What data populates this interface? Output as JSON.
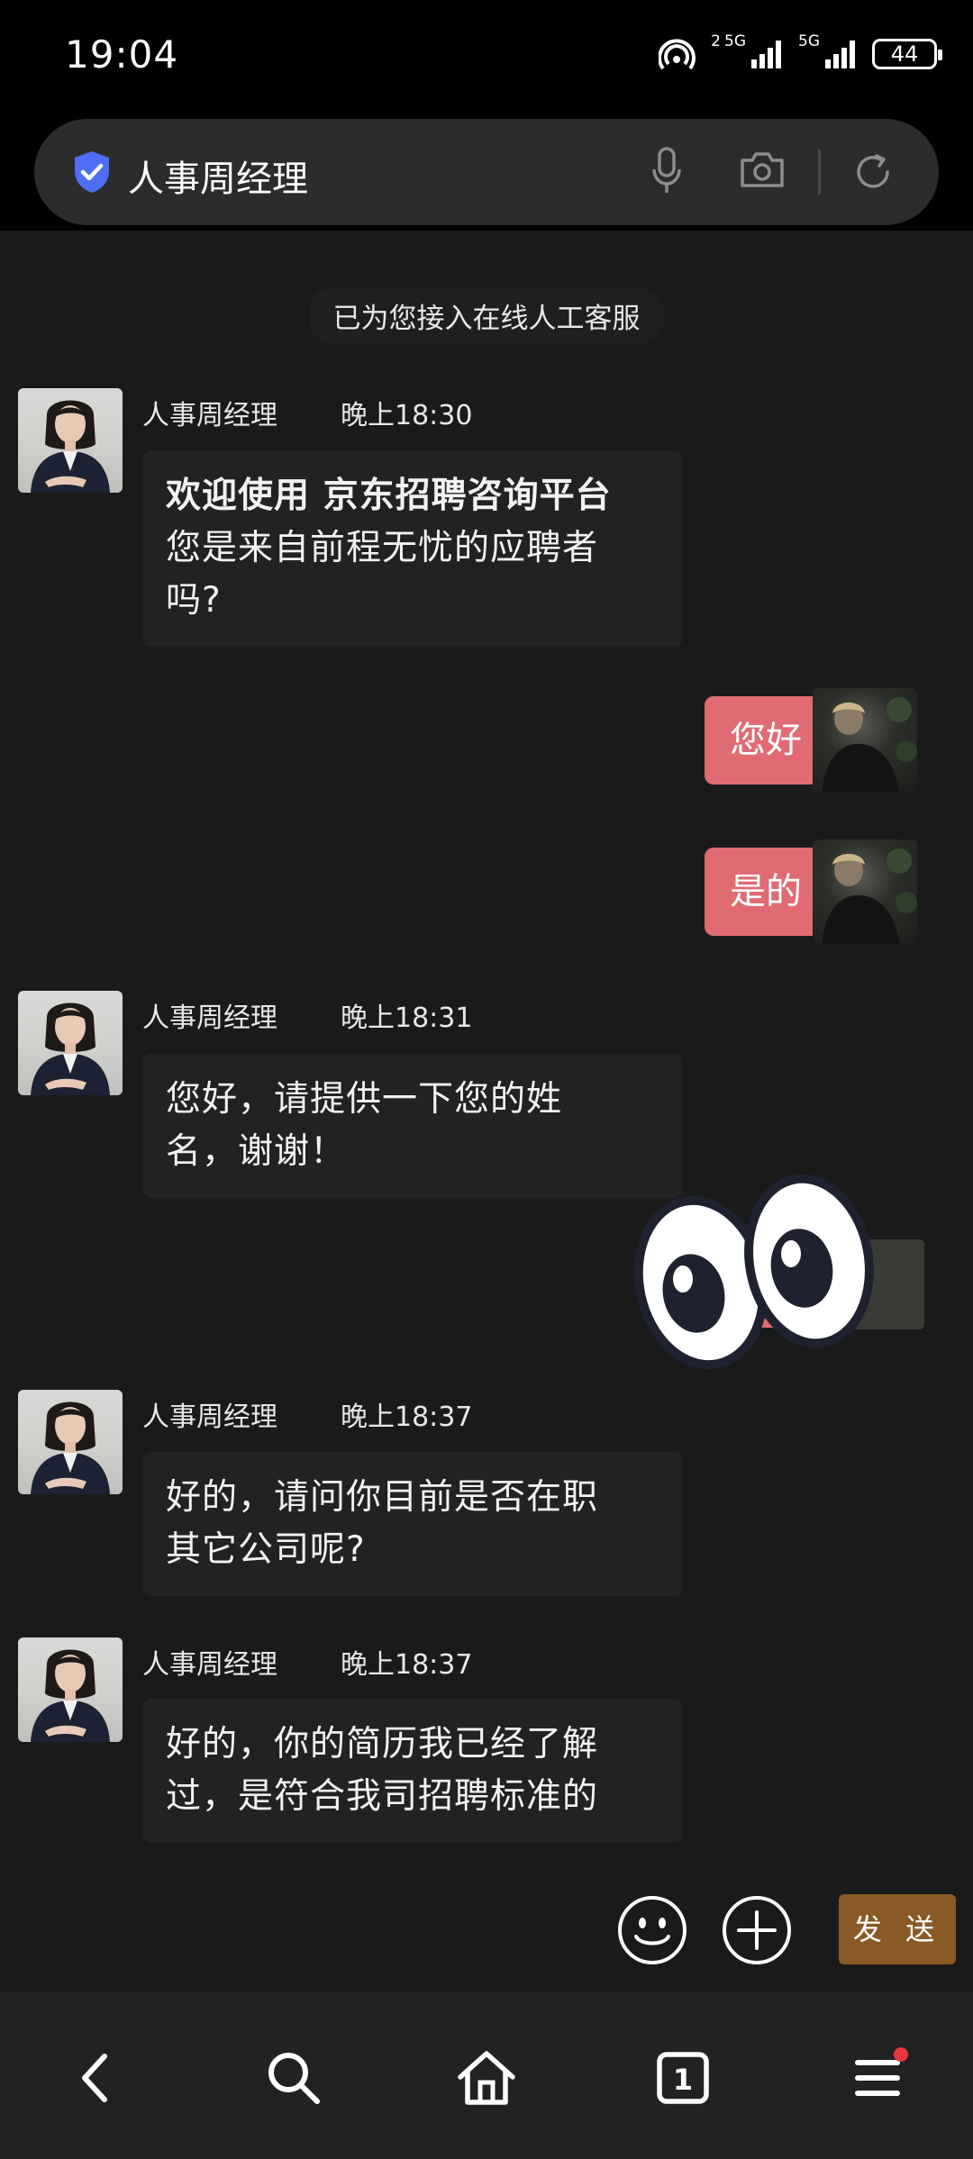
{
  "status_bar": {
    "time": "19:04",
    "network": "5G",
    "network2": "5G",
    "hotspot_badge": "2",
    "battery": "44"
  },
  "address_bar": {
    "title": "人事周经理",
    "icons": [
      "shield-check-icon",
      "microphone-icon",
      "camera-icon",
      "reload-icon"
    ]
  },
  "chat": {
    "system_note": "已为您接入在线人工客服",
    "messages": [
      {
        "sender": "人事周经理",
        "time": "晚上18:30",
        "title": "欢迎使用 京东招聘咨询平台",
        "lines": [
          "您是来自前程无忧的应聘者",
          "吗?"
        ]
      },
      {
        "sender": "me",
        "text": "您好"
      },
      {
        "sender": "me",
        "text": "是的"
      },
      {
        "sender": "人事周经理",
        "time": "晚上18:31",
        "lines": [
          "您好，请提供一下您的姓",
          "名，谢谢！"
        ]
      },
      {
        "sender": "人事周经理",
        "time": "晚上18:37",
        "lines": [
          "好的，请问你目前是否在职",
          "其它公司呢?"
        ]
      },
      {
        "sender": "人事周经理",
        "time": "晚上18:37",
        "lines": [
          "好的，你的简历我已经了解",
          "过，是符合我司招聘标准的"
        ]
      }
    ]
  },
  "compose": {
    "send_label": "发 送",
    "icons": [
      "emoji-icon",
      "plus-icon"
    ]
  },
  "bottom_nav": {
    "tab_count": "1",
    "icons": [
      "back-icon",
      "search-icon",
      "home-icon",
      "tabs-icon",
      "menu-icon"
    ]
  },
  "colors": {
    "outgoing_bubble": "#e06b73",
    "send_button": "#8a5a26",
    "background": "#1a1a1a",
    "shield": "#4f6df5"
  }
}
